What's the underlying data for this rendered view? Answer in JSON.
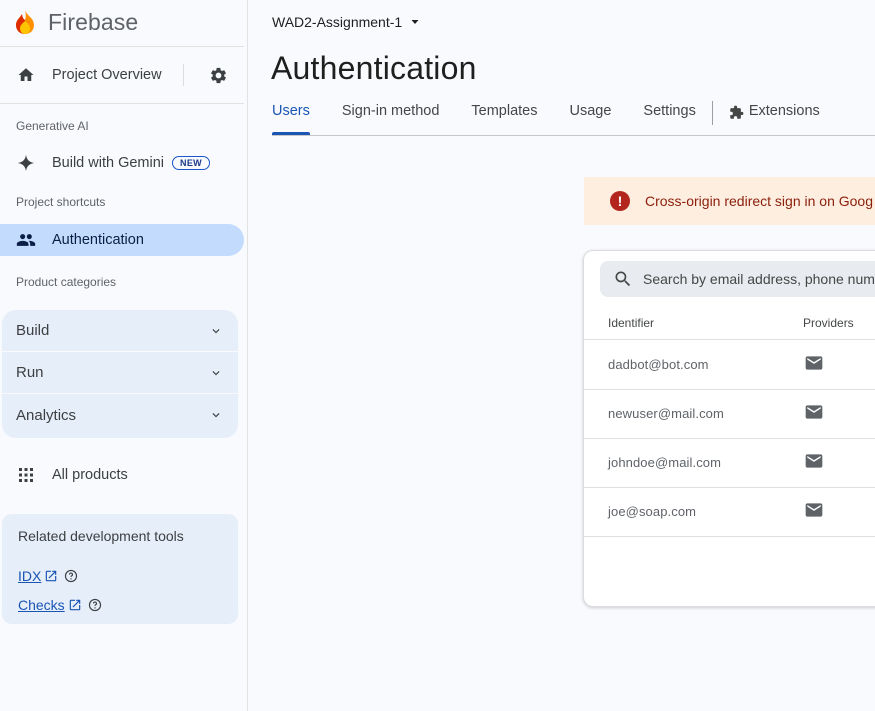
{
  "app": {
    "name": "Firebase"
  },
  "sidebar": {
    "overview_label": "Project Overview",
    "generative_ai_label": "Generative AI",
    "gemini_label": "Build with Gemini",
    "new_badge": "NEW",
    "shortcuts_label": "Project shortcuts",
    "authentication_label": "Authentication",
    "categories_label": "Product categories",
    "categories": [
      "Build",
      "Run",
      "Analytics"
    ],
    "all_products_label": "All products",
    "tools": {
      "title": "Related development tools",
      "links": [
        "IDX",
        "Checks"
      ]
    }
  },
  "header": {
    "project_name": "WAD2-Assignment-1",
    "page_title": "Authentication"
  },
  "tabs": [
    "Users",
    "Sign-in method",
    "Templates",
    "Usage",
    "Settings",
    "Extensions"
  ],
  "active_tab": "Users",
  "alert": {
    "text": "Cross-origin redirect sign in on Goog"
  },
  "users_table": {
    "search_placeholder": "Search by email address, phone numb",
    "columns": [
      "Identifier",
      "Providers"
    ],
    "rows": [
      {
        "identifier": "dadbot@bot.com",
        "provider_icon": "mail-icon"
      },
      {
        "identifier": "newuser@mail.com",
        "provider_icon": "mail-icon"
      },
      {
        "identifier": "johndoe@mail.com",
        "provider_icon": "mail-icon"
      },
      {
        "identifier": "joe@soap.com",
        "provider_icon": "mail-icon"
      }
    ]
  },
  "colors": {
    "accent": "#1a55b5",
    "active_nav": "#c3dbfd",
    "alert_bg": "#fdeee0",
    "alert_icon": "#b3261e"
  }
}
